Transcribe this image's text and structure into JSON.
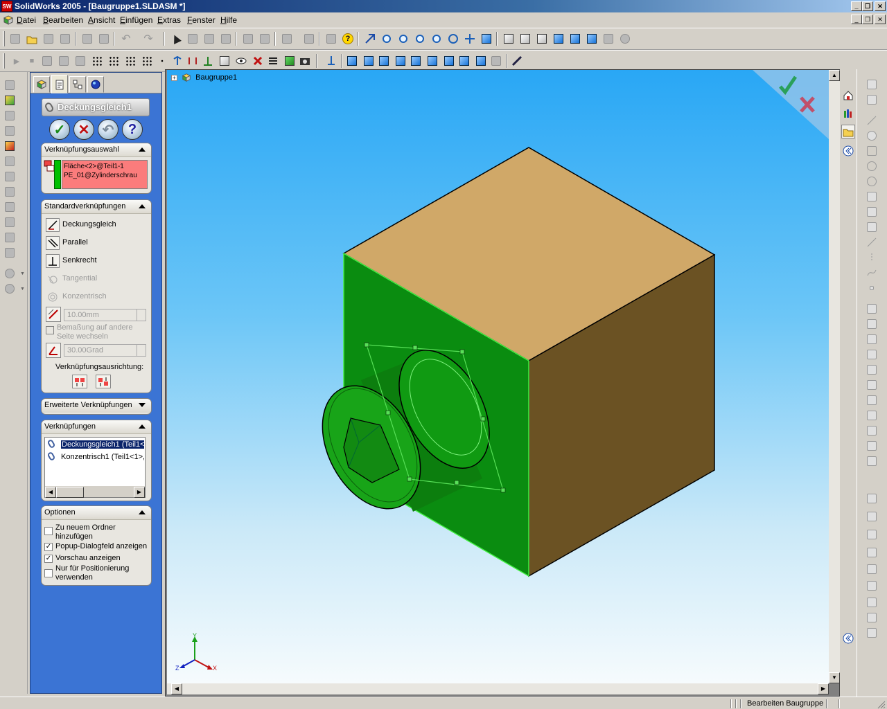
{
  "window": {
    "title": "SolidWorks 2005 - [Baugruppe1.SLDASM *]",
    "app_icon_label": "SW"
  },
  "menu": {
    "items": [
      "Datei",
      "Bearbeiten",
      "Ansicht",
      "Einfügen",
      "Extras",
      "Fenster",
      "Hilfe"
    ]
  },
  "property_manager": {
    "title": "Deckungsgleich1",
    "buttons": {
      "ok": "✓",
      "cancel": "✕",
      "undo": "↶",
      "help": "?"
    },
    "selection_section": {
      "header": "Verknüpfungsauswahl",
      "items": [
        "Fläche<2>@Teil1-1",
        "PE_01@Zylinderschrau"
      ]
    },
    "standard_section": {
      "header": "Standardverknüpfungen",
      "options": [
        {
          "label": "Deckungsgleich",
          "enabled": true
        },
        {
          "label": "Parallel",
          "enabled": true
        },
        {
          "label": "Senkrecht",
          "enabled": true
        },
        {
          "label": "Tangential",
          "enabled": false
        },
        {
          "label": "Konzentrisch",
          "enabled": false
        }
      ],
      "distance_value": "10.00mm",
      "flip_dimension_label": "Bemaßung auf andere Seite wechseln",
      "angle_value": "30.00Grad",
      "alignment_label": "Verknüpfungsausrichtung:"
    },
    "advanced_section": {
      "header": "Erweiterte Verknüpfungen"
    },
    "mates_section": {
      "header": "Verknüpfungen",
      "items": [
        {
          "label": "Deckungsgleich1 (Teil1<1",
          "selected": true
        },
        {
          "label": "Konzentrisch1 (Teil1<1>,",
          "selected": false
        }
      ]
    },
    "options_section": {
      "header": "Optionen",
      "options": [
        {
          "label": "Zu neuem Ordner hinzufügen",
          "checked": false
        },
        {
          "label": "Popup-Dialogfeld anzeigen",
          "checked": true
        },
        {
          "label": "Vorschau anzeigen",
          "checked": true
        },
        {
          "label": "Nur für Positionierung verwenden",
          "checked": false
        }
      ]
    }
  },
  "graphics": {
    "tree_root": "Baugruppe1",
    "tree_expander": "+",
    "triad": {
      "x": "X",
      "y": "Y",
      "z": "Z"
    }
  },
  "statusbar": {
    "text": "Bearbeiten Baugruppe"
  },
  "colors": {
    "cube_top": "#d0a868",
    "cube_right": "#6b5223",
    "cube_front_selected": "#0a8c10",
    "screw": "#18a418",
    "preview_plane": "#58e058",
    "selection_list_bg": "#fb7c7c",
    "pm_panel_bg": "#3b74d4"
  }
}
